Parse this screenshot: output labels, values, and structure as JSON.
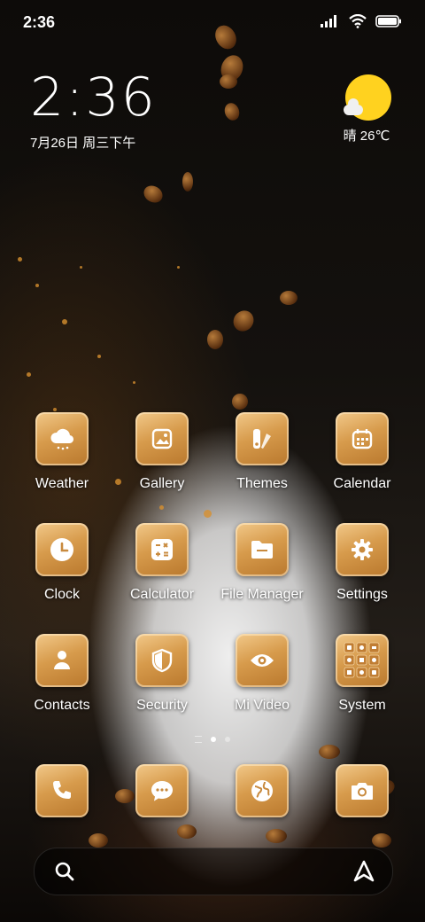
{
  "status_bar": {
    "time": "2:36",
    "icons": [
      "signal-icon",
      "wifi-icon",
      "battery-icon"
    ]
  },
  "clock_widget": {
    "time": "2:36",
    "date": "7月26日 周三下午"
  },
  "weather_widget": {
    "icon": "sunny-cloud-icon",
    "text": "晴 26℃"
  },
  "apps": [
    {
      "label": "Weather",
      "icon": "weather-icon"
    },
    {
      "label": "Gallery",
      "icon": "gallery-icon"
    },
    {
      "label": "Themes",
      "icon": "themes-icon"
    },
    {
      "label": "Calendar",
      "icon": "calendar-icon"
    },
    {
      "label": "Clock",
      "icon": "clock-icon"
    },
    {
      "label": "Calculator",
      "icon": "calculator-icon"
    },
    {
      "label": "File Manager",
      "icon": "folder-icon"
    },
    {
      "label": "Settings",
      "icon": "gear-icon"
    },
    {
      "label": "Contacts",
      "icon": "contacts-icon"
    },
    {
      "label": "Security",
      "icon": "shield-icon"
    },
    {
      "label": "Mi Video",
      "icon": "eye-icon"
    },
    {
      "label": "System",
      "icon": "folder-grid-icon"
    }
  ],
  "dock": [
    {
      "name": "phone",
      "icon": "phone-icon"
    },
    {
      "name": "messages",
      "icon": "message-icon"
    },
    {
      "name": "browser",
      "icon": "globe-icon"
    },
    {
      "name": "camera",
      "icon": "camera-icon"
    }
  ],
  "page_indicator": {
    "pages": 2,
    "current": 1
  },
  "search_bar": {
    "left_icon": "search-icon",
    "right_icon": "assistant-icon"
  },
  "colors": {
    "icon_gold": "#d79b4c",
    "sun": "#ffd21f"
  }
}
